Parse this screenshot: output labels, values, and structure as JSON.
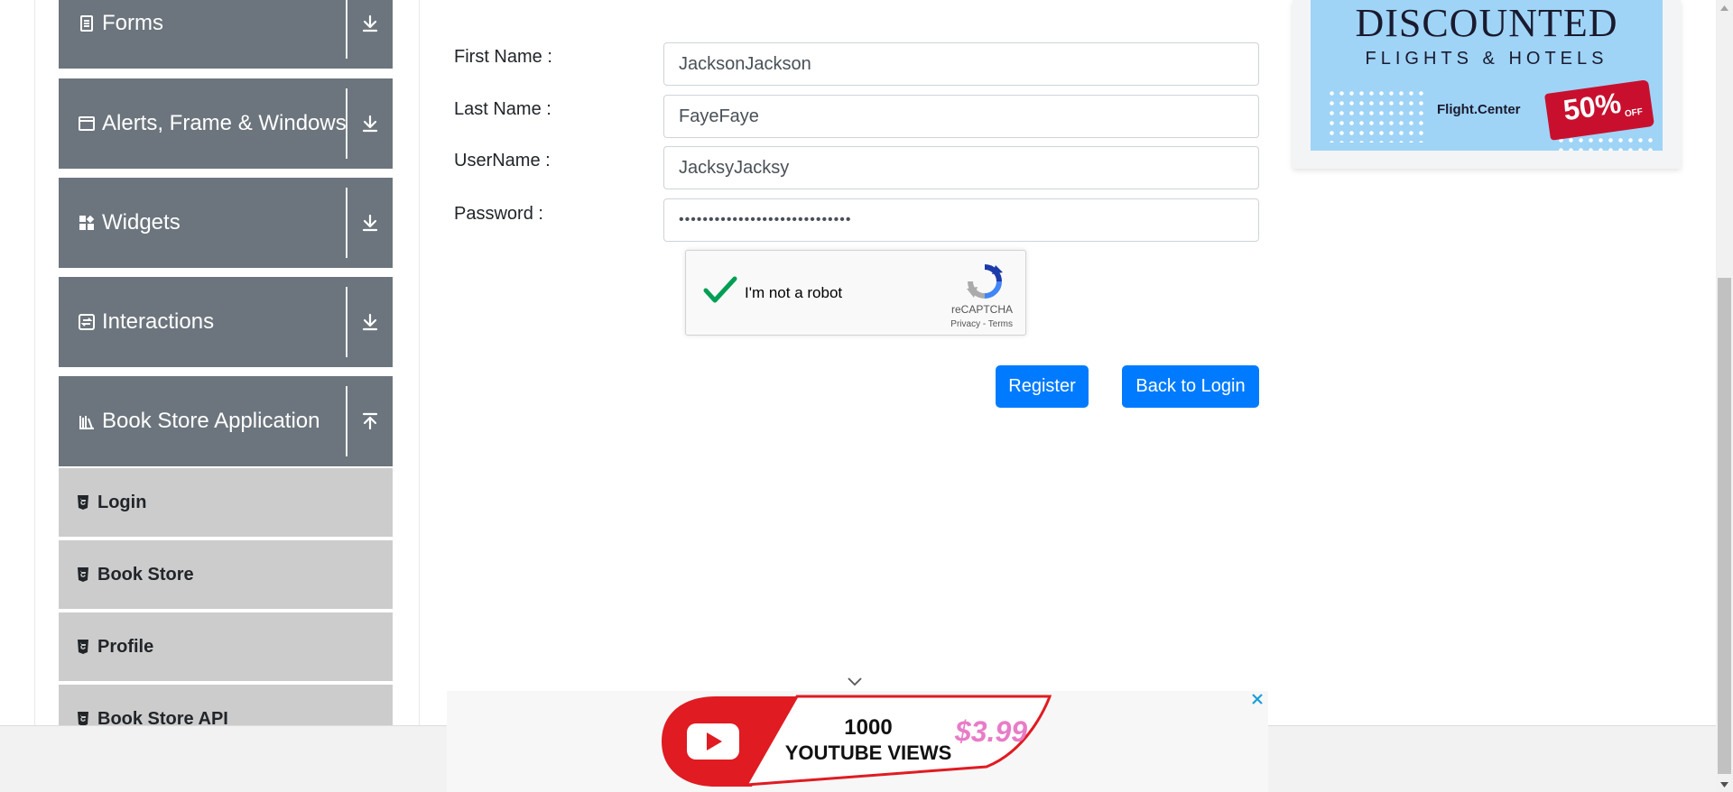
{
  "sidebar": {
    "groups": [
      {
        "label": "Forms",
        "icon": "document-icon",
        "toggle": "expand-arrow-icon"
      },
      {
        "label": "Alerts, Frame & Windows",
        "icon": "window-icon",
        "toggle": "expand-arrow-icon"
      },
      {
        "label": "Widgets",
        "icon": "widgets-icon",
        "toggle": "expand-arrow-icon"
      },
      {
        "label": "Interactions",
        "icon": "interactions-icon",
        "toggle": "expand-arrow-icon"
      },
      {
        "label": "Book Store Application",
        "icon": "books-icon",
        "toggle": "collapse-arrow-icon"
      }
    ],
    "submenu": [
      {
        "label": "Login",
        "icon": "html5-icon"
      },
      {
        "label": "Book Store",
        "icon": "html5-icon"
      },
      {
        "label": "Profile",
        "icon": "html5-icon"
      },
      {
        "label": "Book Store API",
        "icon": "html5-icon"
      }
    ]
  },
  "form": {
    "first_name_label": "First Name :",
    "first_name_value": "JacksonJackson",
    "last_name_label": "Last Name :",
    "last_name_value": "FayeFaye",
    "username_label": "UserName :",
    "username_value": "JacksyJacksy",
    "password_label": "Password :",
    "password_value": "•••••••••••••••••••••••••••••"
  },
  "captcha": {
    "checked": true,
    "text": "I'm not a robot",
    "brand": "reCAPTCHA",
    "terms": "Privacy - Terms"
  },
  "buttons": {
    "register": "Register",
    "back_to_login": "Back to Login"
  },
  "ad_right": {
    "headline": "DISCOUNTED",
    "subline": "FLIGHTS & HOTELS",
    "brand": "Flight.Center",
    "discount": "50%",
    "off": "OFF"
  },
  "ad_bottom": {
    "line1": "1000",
    "line2": "YOUTUBE VIEWS",
    "price": "$3.99"
  },
  "colors": {
    "primary": "#007bff",
    "sidebar_group": "#6c757d",
    "submenu": "#cccccc",
    "recaptcha_check": "#009e55"
  }
}
